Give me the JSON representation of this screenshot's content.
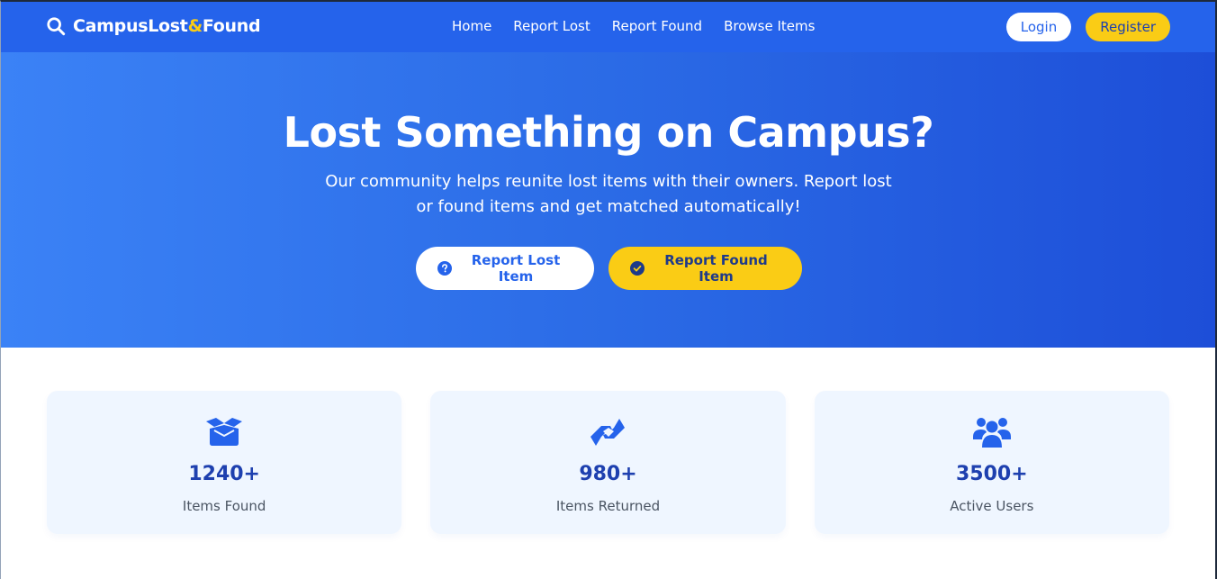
{
  "nav": {
    "brand_part1": "CampusLost",
    "brand_amp": "&",
    "brand_part2": "Found",
    "links": [
      "Home",
      "Report Lost",
      "Report Found",
      "Browse Items"
    ],
    "login_label": "Login",
    "register_label": "Register"
  },
  "hero": {
    "title": "Lost Something on Campus?",
    "subtitle": "Our community helps reunite lost items with their owners. Report lost or found items and get matched automatically!",
    "report_lost_label": "Report Lost Item",
    "report_found_label": "Report Found Item"
  },
  "stats": [
    {
      "icon": "box-open-icon",
      "value": "1240+",
      "label": "Items Found"
    },
    {
      "icon": "handshake-icon",
      "value": "980+",
      "label": "Items Returned"
    },
    {
      "icon": "users-icon",
      "value": "3500+",
      "label": "Active Users"
    }
  ],
  "colors": {
    "primary": "#2563eb",
    "accent": "#facc15",
    "stat_text": "#1e40af",
    "card_bg": "#eff6ff"
  }
}
